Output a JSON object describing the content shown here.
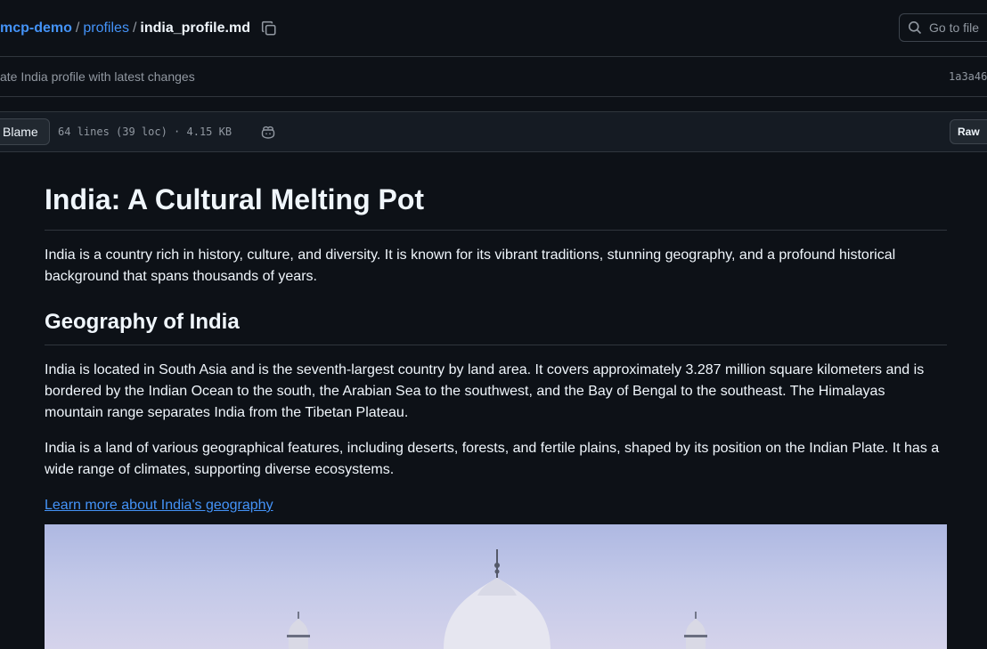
{
  "breadcrumb": {
    "repo": "mcp-demo",
    "sep1": "/",
    "folder": "profiles",
    "sep2": "/",
    "file": "india_profile.md"
  },
  "search": {
    "label": "Go to file"
  },
  "commit": {
    "message": "ate India profile with latest changes",
    "hash": "1a3a46"
  },
  "filebar": {
    "blame_label": "Blame",
    "info": "64 lines (39 loc) · 4.15 KB",
    "raw_label": "Raw"
  },
  "article": {
    "title": "India: A Cultural Melting Pot",
    "intro": "India is a country rich in history, culture, and diversity. It is known for its vibrant traditions, stunning geography, and a profound historical background that spans thousands of years.",
    "geo_heading": "Geography of India",
    "geo_p1": "India is located in South Asia and is the seventh-largest country by land area. It covers approximately 3.287 million square kilometers and is bordered by the Indian Ocean to the south, the Arabian Sea to the southwest, and the Bay of Bengal to the southeast. The Himalayas mountain range separates India from the Tibetan Plateau.",
    "geo_p2": "India is a land of various geographical features, including deserts, forests, and fertile plains, shaped by its position on the Indian Plate. It has a wide range of climates, supporting diverse ecosystems.",
    "geo_link": "Learn more about India's geography"
  },
  "colors": {
    "background": "#0d1117",
    "link": "#4493f8",
    "border": "#30363d",
    "muted": "#9198a1"
  },
  "icons": [
    "copy-icon",
    "search-icon",
    "copilot-icon"
  ]
}
